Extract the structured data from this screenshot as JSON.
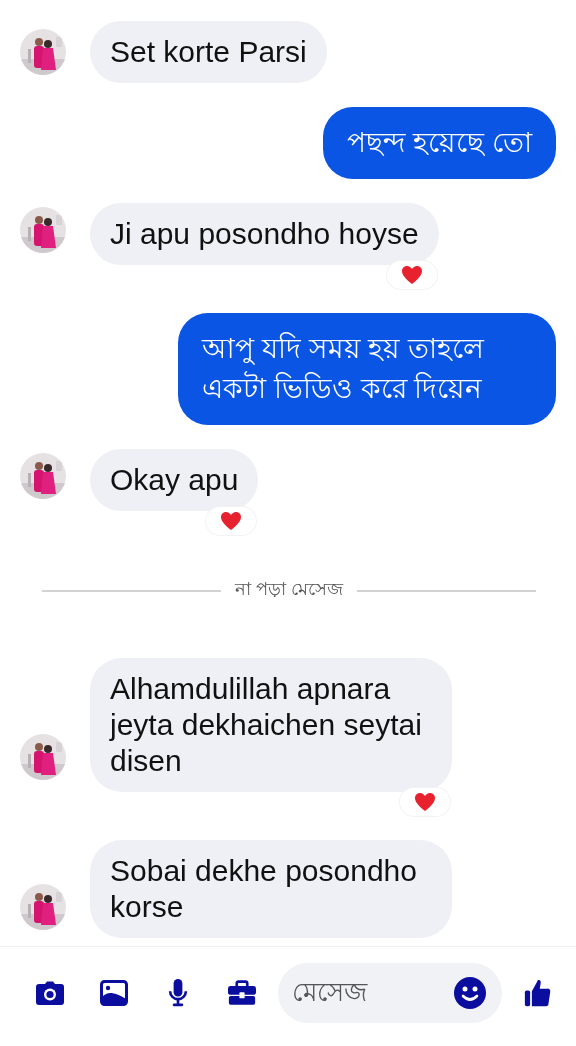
{
  "messages": [
    {
      "kind": "received",
      "text": "Set korte Parsi",
      "reacted": false
    },
    {
      "kind": "sent",
      "text": "পছন্দ হয়েছে তো",
      "reacted": false
    },
    {
      "kind": "received",
      "text": "Ji apu posondho hoyse",
      "reacted": true
    },
    {
      "kind": "sent",
      "text": "আপু যদি সময় হয় তাহলে একটা ভিডিও করে দিয়েন",
      "reacted": false
    },
    {
      "kind": "received",
      "text": "Okay apu",
      "reacted": true
    },
    {
      "kind": "divider",
      "text": "না পড়া মেসেজ"
    },
    {
      "kind": "received",
      "text": "Alhamdulillah apnara jeyta dekhaichen seytai disen",
      "reacted": true
    },
    {
      "kind": "received",
      "text": "Sobai dekhe posondho korse",
      "reacted": false
    }
  ],
  "composer": {
    "placeholder": "মেসেজ"
  }
}
